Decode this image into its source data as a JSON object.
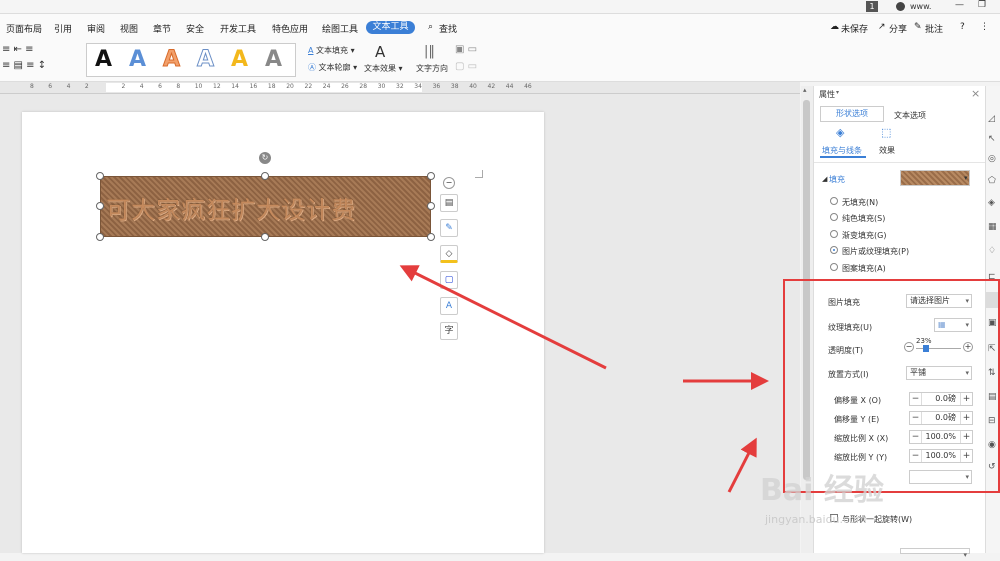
{
  "topbar": {
    "badge": "1",
    "url": "www."
  },
  "menu": {
    "items": [
      "页面布局",
      "引用",
      "审阅",
      "视图",
      "章节",
      "安全",
      "开发工具",
      "特色应用",
      "绘图工具"
    ],
    "active": "文本工具",
    "search": "查找",
    "unsaved": "未保存",
    "share": "分享",
    "comment": "批注",
    "help": "?"
  },
  "ribbon": {
    "style_letter": "A",
    "text_fill": "文本填充",
    "text_outline": "文本轮廓",
    "text_effect": "文本效果",
    "text_direction": "文字方向"
  },
  "ruler": {
    "ticks": [
      "8",
      "6",
      "4",
      "2",
      "",
      "2",
      "4",
      "6",
      "8",
      "10",
      "12",
      "14",
      "16",
      "18",
      "20",
      "22",
      "24",
      "26",
      "28",
      "30",
      "32",
      "34",
      "36",
      "38",
      "40",
      "42",
      "44",
      "46"
    ]
  },
  "document": {
    "wordart_text": "可大家疯狂扩大设计费"
  },
  "float_tools": {
    "collapse": "−",
    "layout": "▤",
    "pen": "✎",
    "fill": "◇",
    "outline": "▢",
    "textbox": "A",
    "char": "字"
  },
  "panel": {
    "header": "属性",
    "close": "×",
    "tabs": [
      "形状选项",
      "文本选项"
    ],
    "subtabs": [
      "填充与线条",
      "效果"
    ],
    "fill_section": "填充",
    "radios": [
      "无填充(N)",
      "纯色填充(S)",
      "渐变填充(G)",
      "图片或纹理填充(P)",
      "图案填充(A)"
    ],
    "selected_radio": 3,
    "picture_fill_label": "图片填充",
    "picture_fill_value": "请选择图片",
    "texture_fill_label": "纹理填充(U)",
    "transparency_label": "透明度(T)",
    "transparency_value": "23%",
    "transparency_fraction": 0.23,
    "placement_label": "放置方式(I)",
    "placement_value": "平铺",
    "offset_x_label": "偏移量 X (O)",
    "offset_x_value": "0.0磅",
    "offset_y_label": "偏移量 Y (E)",
    "offset_y_value": "0.0磅",
    "scale_x_label": "缩放比例 X (X)",
    "scale_x_value": "100.0%",
    "scale_y_label": "缩放比例 Y (Y)",
    "scale_y_value": "100.0%",
    "rotate_label": "与形状一起旋转(W)"
  },
  "watermark": {
    "text": "Bai 经验",
    "url": "jingyan.baidu.com"
  },
  "colors": {
    "accent": "#3b7fd6",
    "annotation": "#e43d3d"
  }
}
